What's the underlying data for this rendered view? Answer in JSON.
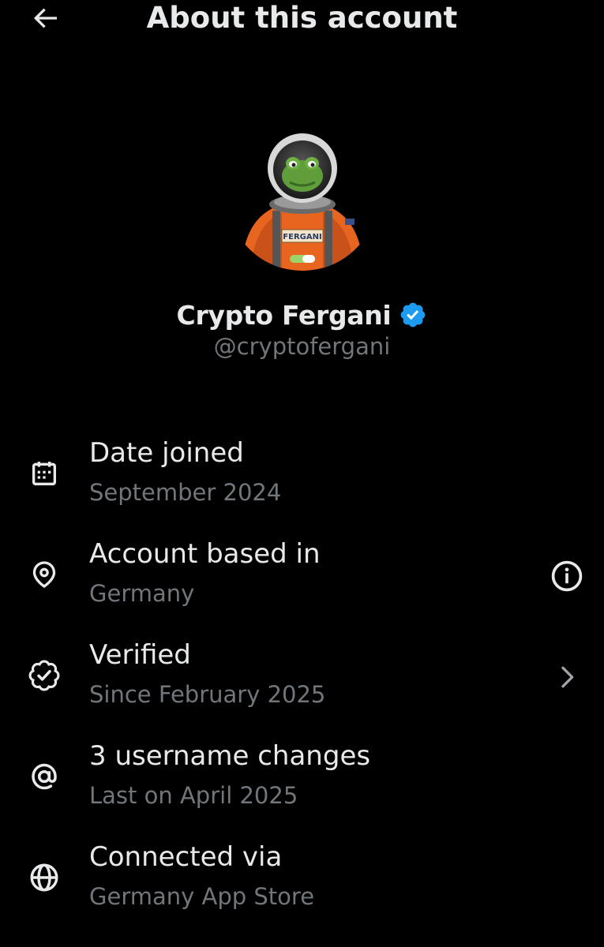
{
  "header": {
    "title": "About this account",
    "back_icon": "arrow-left-icon"
  },
  "profile": {
    "display_name": "Crypto Fergani",
    "handle": "@cryptofergani",
    "verified": true,
    "verified_badge_color": "#1d9bf0",
    "avatar_badge_text": "FERGANI"
  },
  "details": [
    {
      "icon": "calendar-icon",
      "title": "Date joined",
      "value": "September 2024"
    },
    {
      "icon": "location-pin-icon",
      "title": "Account based in",
      "value": "Germany",
      "trailing_icon": "info-icon"
    },
    {
      "icon": "verified-outline-icon",
      "title": "Verified",
      "value": "Since February 2025",
      "trailing_icon": "chevron-right-icon"
    },
    {
      "icon": "at-sign-icon",
      "title": "3 username changes",
      "value": "Last on April 2025"
    },
    {
      "icon": "globe-icon",
      "title": "Connected via",
      "value": "Germany App Store"
    }
  ],
  "colors": {
    "background": "#000000",
    "primary_text": "#e7e9ea",
    "secondary_text": "#71767b",
    "accent": "#1d9bf0"
  }
}
